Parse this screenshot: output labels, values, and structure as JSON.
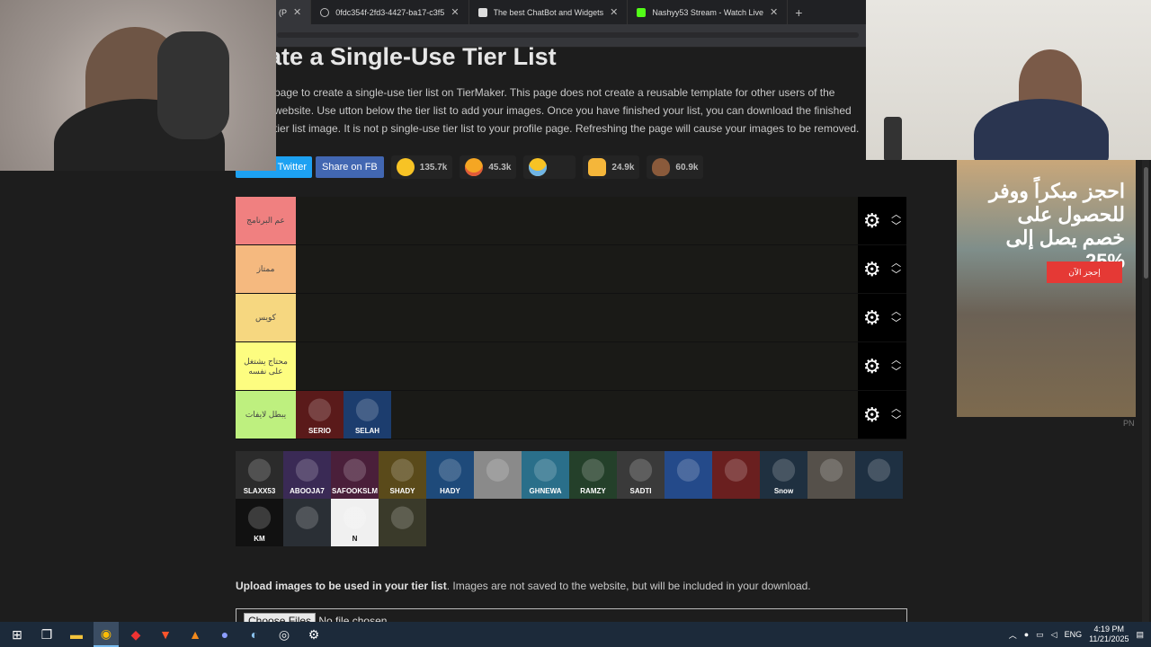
{
  "browser": {
    "tabs": [
      {
        "title": "(P",
        "active": true
      },
      {
        "title": "0fdc354f-2fd3-4427-ba17-c3f5"
      },
      {
        "title": "The best ChatBot and Widgets"
      },
      {
        "title": "Nashyy53 Stream - Watch Live"
      }
    ],
    "new_tab": "+"
  },
  "page": {
    "title": "ate a Single-Use Tier List",
    "intro": "page to create a single-use tier list on TierMaker. This page does not create a reusable template for other users of the website. Use utton below the tier list to add your images. Once you have finished your list, you can download the finished tier list image. It is not p single-use tier list to your profile page. Refreshing the page will cause your images to be removed."
  },
  "share": {
    "twitter_label": "n Twitter",
    "fb_label": "Share on FB",
    "reactions": [
      {
        "icon": "grinning-emoji-icon",
        "count": "135.7k"
      },
      {
        "icon": "heart-eyes-emoji-icon",
        "count": "45.3k"
      },
      {
        "icon": "laughing-emoji-icon",
        "count": ""
      },
      {
        "icon": "raised-hands-emoji-icon",
        "count": "24.9k"
      },
      {
        "icon": "poop-emoji-icon",
        "count": "60.9k"
      }
    ]
  },
  "tiers": [
    {
      "label": "عم البرنامج",
      "color": "#f08080"
    },
    {
      "label": "ممتاز",
      "color": "#f5b97f"
    },
    {
      "label": "كويس",
      "color": "#f6d780"
    },
    {
      "label": "محتاج يشتغل على نفسه",
      "color": "#fdfd80"
    },
    {
      "label": "يبطل لايفات",
      "color": "#bef07f"
    }
  ],
  "tier_items": {
    "last_tier": [
      {
        "name": "SERIO",
        "color": "#5a1a1a"
      },
      {
        "name": "SELAH",
        "color": "#1c3d6e"
      }
    ]
  },
  "pool": [
    {
      "name": "SLAXX53",
      "color": "#2b2b2b"
    },
    {
      "name": "ABOOJA7",
      "color": "#3a2a55"
    },
    {
      "name": "SAFOOKSLM",
      "color": "#4a1f3a"
    },
    {
      "name": "SHADY",
      "color": "#5a4a1a"
    },
    {
      "name": "HADY",
      "color": "#1e4a7a"
    },
    {
      "name": "",
      "color": "#8a8a8a"
    },
    {
      "name": "GHNEWA",
      "color": "#2a6f8a"
    },
    {
      "name": "RAMZY",
      "color": "#24402a"
    },
    {
      "name": "SADTI",
      "color": "#3a3a3a"
    },
    {
      "name": "",
      "color": "#244a8a"
    },
    {
      "name": "",
      "color": "#6a1f1f"
    },
    {
      "name": "Snow",
      "color": "#1f3040"
    },
    {
      "name": "",
      "color": "#55504a"
    },
    {
      "name": "",
      "color": "#1e3042"
    },
    {
      "name": "KM",
      "color": "#111111"
    },
    {
      "name": "",
      "color": "#2a2f35"
    },
    {
      "name": "N",
      "color": "#f0f0f0"
    },
    {
      "name": "",
      "color": "#3a3a2a"
    }
  ],
  "upload": {
    "bold": "Upload images to be used in your tier list",
    "rest": ". Images are not saved to the website, but will be included in your download.",
    "choose_files": "Choose Files",
    "no_file": "No file chosen"
  },
  "ad": {
    "headline": "احجز مبكراً ووفر للحصول على خصم يصل إلى 25%",
    "cta": "إحجز الآن",
    "pn": "PN"
  },
  "taskbar": {
    "time": "4:19 PM",
    "date": "11/21/2025",
    "lang": "ENG"
  }
}
